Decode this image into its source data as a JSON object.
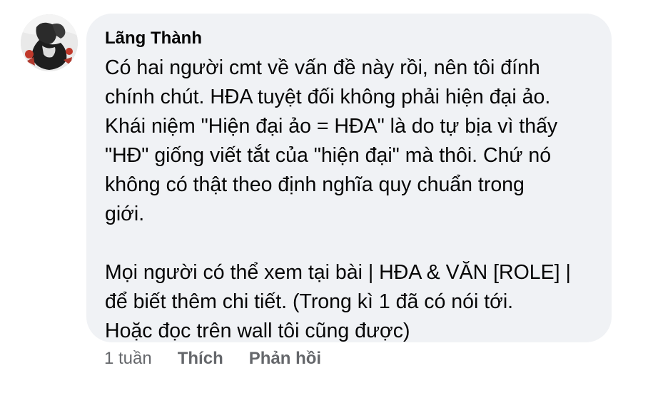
{
  "comment": {
    "author": "Lãng Thành",
    "paragraphs": [
      "Có hai người cmt về vấn đề này rồi, nên tôi đính\nchính chút. HĐA tuyệt đối không phải hiện đại ảo.\nKhái niệm \"Hiện đại ảo = HĐA\" là do tự bịa vì thấy\n\"HĐ\" giống viết tắt của \"hiện đại\" mà thôi. Chứ nó\nkhông có thật theo định nghĩa quy chuẩn trong\ngiới.",
      "Mọi người có thể xem tại bài | HĐA & VĂN [ROLE] |\nđể biết thêm chi tiết. (Trong kì 1 đã có nói tới.\nHoặc đọc trên wall tôi cũng được)"
    ],
    "bubble_color": "#f0f2f5",
    "text_color": "#050505",
    "meta_color": "#65676b"
  },
  "actions": {
    "time": "1 tuần",
    "like_label": "Thích",
    "reply_label": "Phản hồi"
  }
}
